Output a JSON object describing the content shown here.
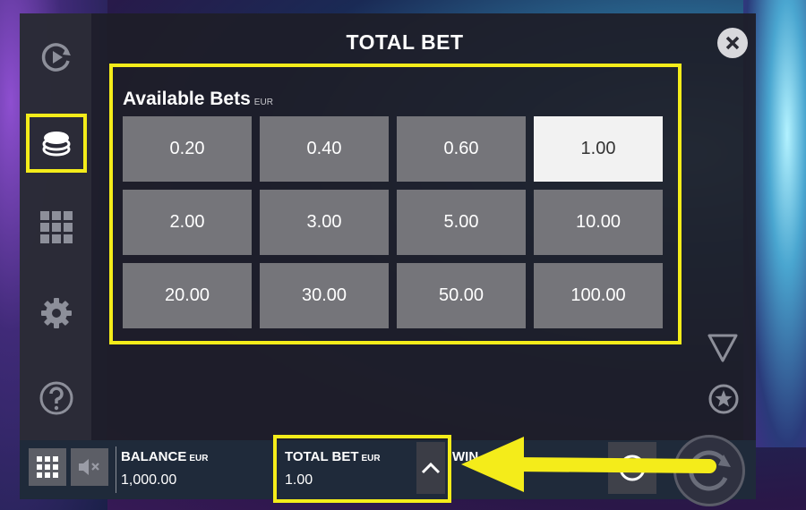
{
  "dialog": {
    "title": "TOTAL BET",
    "section_title": "Available Bets",
    "section_unit": "EUR"
  },
  "bets": [
    {
      "label": "0.20",
      "selected": false
    },
    {
      "label": "0.40",
      "selected": false
    },
    {
      "label": "0.60",
      "selected": false
    },
    {
      "label": "1.00",
      "selected": true
    },
    {
      "label": "2.00",
      "selected": false
    },
    {
      "label": "3.00",
      "selected": false
    },
    {
      "label": "5.00",
      "selected": false
    },
    {
      "label": "10.00",
      "selected": false
    },
    {
      "label": "20.00",
      "selected": false
    },
    {
      "label": "30.00",
      "selected": false
    },
    {
      "label": "50.00",
      "selected": false
    },
    {
      "label": "100.00",
      "selected": false
    }
  ],
  "sidebar": {
    "items": [
      {
        "icon": "autoplay-icon"
      },
      {
        "icon": "coins-icon",
        "active": true
      },
      {
        "icon": "grid-icon"
      },
      {
        "icon": "gear-icon"
      },
      {
        "icon": "help-icon"
      }
    ]
  },
  "bottom_bar": {
    "balance_label": "BALANCE",
    "balance_unit": "EUR",
    "balance_value": "1,000.00",
    "total_bet_label": "TOTAL BET",
    "total_bet_unit": "EUR",
    "total_bet_value": "1.00",
    "win_label": "WIN"
  },
  "colors": {
    "highlight": "#f4ec1a",
    "bet_button": "#75757a",
    "bet_selected": "#f2f2f2"
  }
}
